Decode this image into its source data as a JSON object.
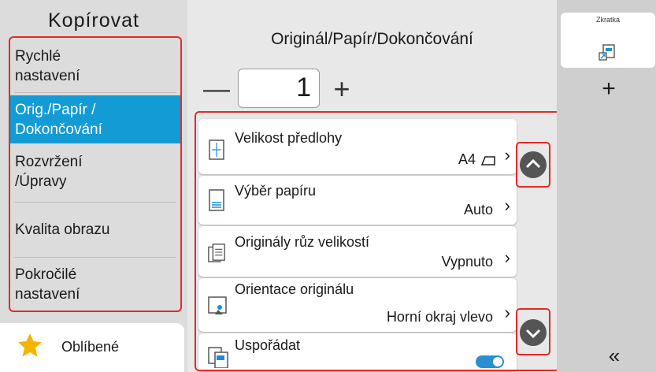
{
  "left": {
    "title": "Kopírovat",
    "tabs": [
      {
        "label": "Rychlé\nnastavení",
        "selected": false
      },
      {
        "label": "Orig./Papír /\nDokončování",
        "selected": true
      },
      {
        "label": "Rozvržení\n/Úpravy",
        "selected": false
      },
      {
        "label": "Kvalita obrazu",
        "selected": false
      },
      {
        "label": "Pokročilé\nnastavení",
        "selected": false
      }
    ],
    "favorites_label": "Oblíbené"
  },
  "center": {
    "title": "Originál/Papír/Dokončování",
    "copies": "1",
    "minus_symbol": "—",
    "plus_symbol": "+",
    "settings": [
      {
        "label": "Velikost předlohy",
        "value": "A4"
      },
      {
        "label": "Výběr papíru",
        "value": "Auto"
      },
      {
        "label": "Originály růz velikostí",
        "value": "Vypnuto"
      },
      {
        "label": "Orientace originálu",
        "value": "Horní okraj vlevo"
      },
      {
        "label": "Uspořádat",
        "value": ""
      }
    ],
    "collate_toggle_on": true
  },
  "right": {
    "shortcut_label": "Zkratka",
    "add_symbol": "+",
    "collapse_symbol": "«"
  },
  "colors": {
    "accent": "#139bd6",
    "highlight_red": "#e22a2a",
    "favorite_star": "#f5b400",
    "toggle_blue": "#2a8fd0"
  }
}
